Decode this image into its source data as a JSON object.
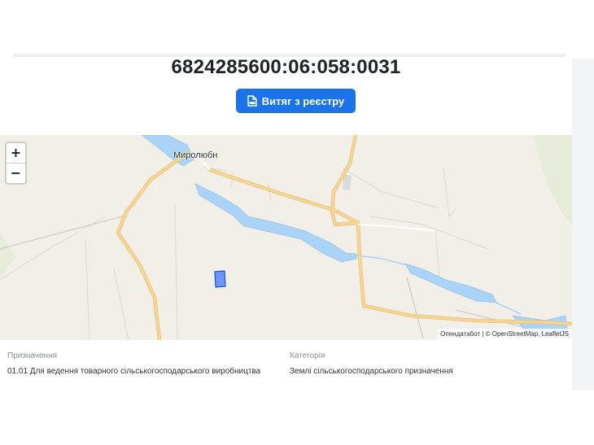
{
  "parcel": {
    "cadastral_number": "6824285600:06:058:0031",
    "extract_button_label": "Витяг з реєстру",
    "extract_button_icon": "pdf-file-icon"
  },
  "map": {
    "zoom_in": "+",
    "zoom_out": "−",
    "place_label": "Миролюбн",
    "attribution": "Опендатабот | © OpenStreetMap, LeafletJS"
  },
  "details": {
    "purpose_label": "Призначення",
    "purpose_value": "01.01 Для ведення товарного сільськогосподарського виробництва",
    "category_label": "Категорія",
    "category_value": "Землі сільськогосподарського призначення"
  },
  "colors": {
    "accent": "#1a73e8",
    "map_background": "#f2efe9",
    "road": "#f7d591",
    "water": "#aad3f8",
    "parcel": "#3f7bff"
  }
}
